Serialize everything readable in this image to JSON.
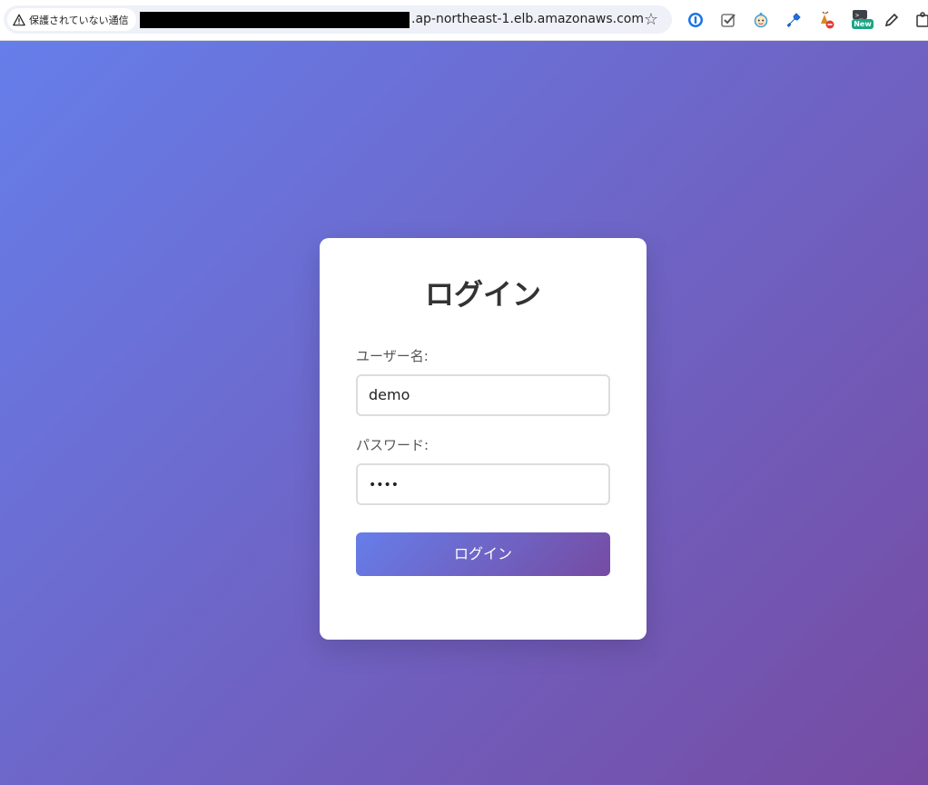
{
  "browser": {
    "security_label": "保護されていない通信",
    "url_suffix": ".ap-northeast-1.elb.amazonaws.com",
    "extensions": [
      "1password-icon",
      "checklist-icon",
      "baby-face-icon",
      "wrench-icon",
      "blocked-extension-icon",
      "new-extension-icon",
      "pen-icon",
      "puzzle-icon"
    ],
    "new_badge": "New"
  },
  "login": {
    "title": "ログイン",
    "username_label": "ユーザー名:",
    "username_value": "demo",
    "password_label": "パスワード:",
    "password_masked": "••••",
    "submit_label": "ログイン"
  },
  "colors": {
    "gradient_start": "#667eea",
    "gradient_end": "#764ba2",
    "card_bg": "#ffffff",
    "title_text": "#333333"
  }
}
